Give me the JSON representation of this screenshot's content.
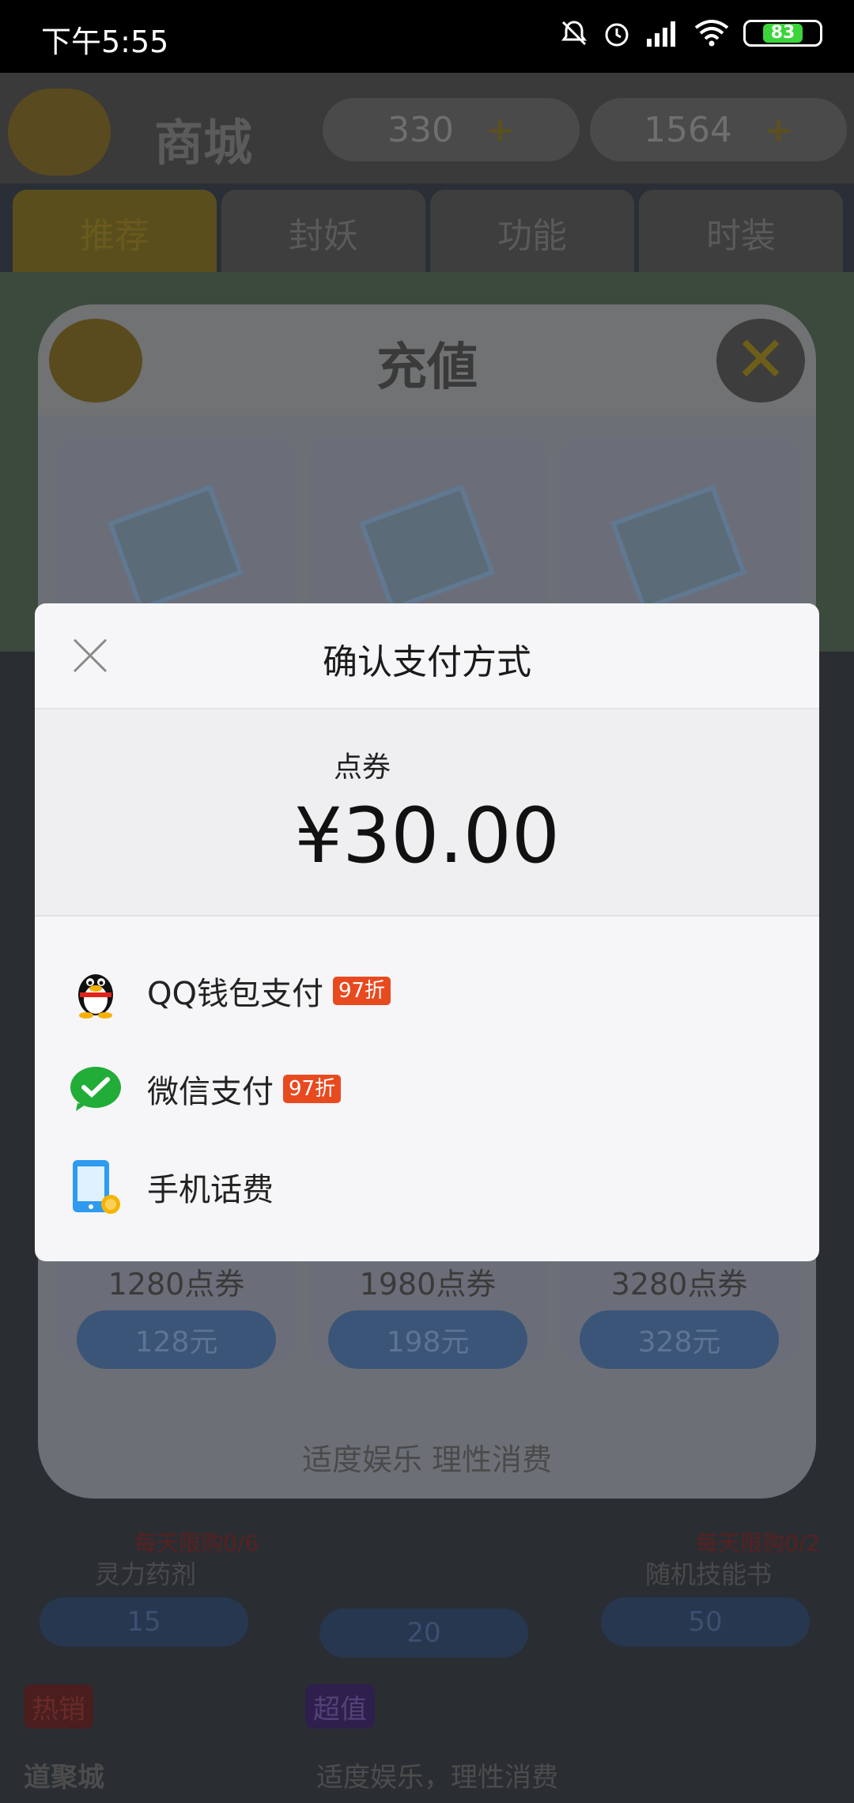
{
  "status_bar": {
    "time": "下午5:55",
    "battery": "83"
  },
  "game": {
    "shop_title": "商城",
    "currency_tickets": "330",
    "currency_gems": "1564",
    "tabs": [
      "推荐",
      "封妖",
      "功能",
      "时装"
    ],
    "recharge_dialog": {
      "title": "充値",
      "packs": [
        {
          "amount": "1280点券",
          "price": "128元"
        },
        {
          "amount": "1980点券",
          "price": "198元"
        },
        {
          "amount": "3280点券",
          "price": "328元"
        }
      ],
      "footer": "适度娱乐 理性消费"
    },
    "bottom": {
      "item1_name": "灵力药剂",
      "item1_limit": "每天限购0/6",
      "item1_price": "15",
      "item2_price": "20",
      "item3_name": "随机技能书",
      "item3_limit": "每天限购0/2",
      "item3_price": "50",
      "hot_tag": "热销",
      "value_tag": "超值",
      "logo_text": "道聚城",
      "slogan": "适度娱乐，理性消费"
    }
  },
  "payment": {
    "title": "确认支付方式",
    "product": "点券",
    "price": "¥30.00",
    "methods": [
      {
        "label": "QQ钱包支付",
        "badge": "97折",
        "icon": "qq-penguin-icon"
      },
      {
        "label": "微信支付",
        "badge": "97折",
        "icon": "wechat-pay-icon"
      },
      {
        "label": "手机话费",
        "icon": "mobile-phone-bill-icon"
      }
    ]
  }
}
